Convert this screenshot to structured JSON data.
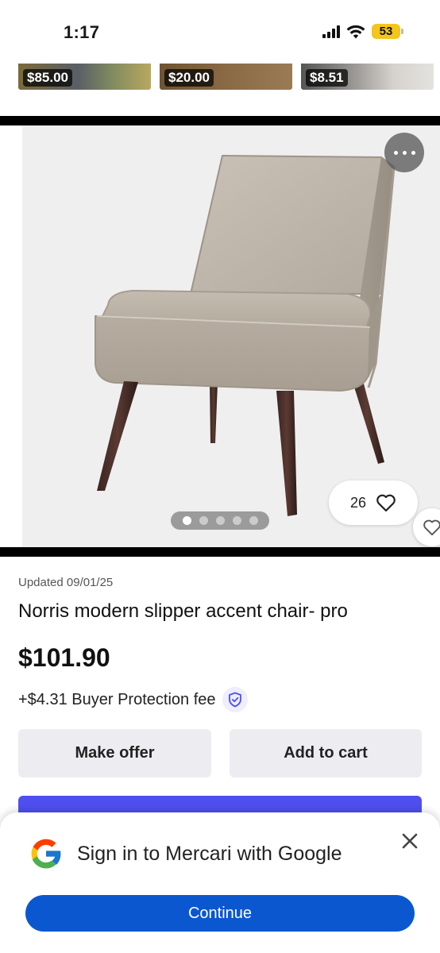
{
  "status_bar": {
    "time": "1:17",
    "battery": "53",
    "battery_color": "#f4c51a"
  },
  "related": [
    {
      "price": "$85.00"
    },
    {
      "price": "$20.00"
    },
    {
      "price": "$8.51"
    }
  ],
  "gallery": {
    "image": "chair-photo",
    "likes": "26",
    "dot_count": 5,
    "active_dot": 1
  },
  "item": {
    "updated": "Updated 09/01/25",
    "title": "Norris modern slipper accent chair- pro",
    "price": "$101.90",
    "fee": "+$4.31 Buyer Protection fee"
  },
  "actions": {
    "make_offer": "Make offer",
    "add_to_cart": "Add to cart",
    "buy_color": "#4f4ff0"
  },
  "google_sheet": {
    "title": "Sign in to Mercari with Google",
    "continue": "Continue",
    "continue_color": "#0b57d0"
  },
  "icons": {
    "more": "more-horizontal-icon",
    "heart": "heart-icon",
    "shield": "shield-check-icon",
    "close": "close-icon",
    "google": "google-logo-icon"
  }
}
